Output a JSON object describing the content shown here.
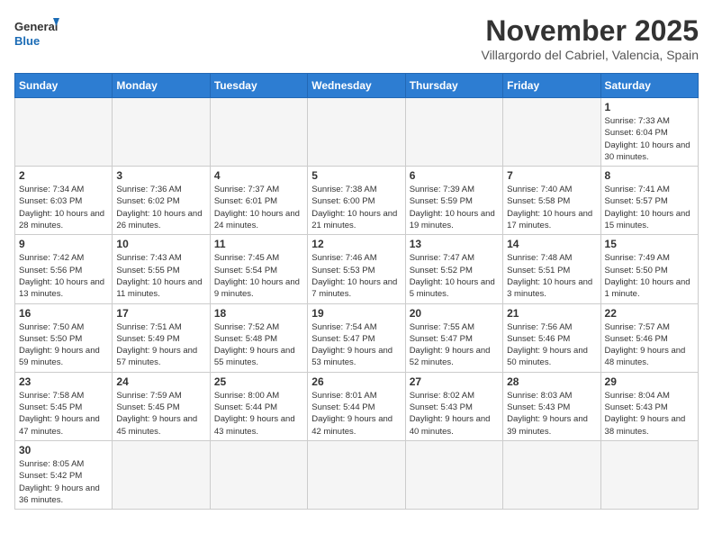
{
  "logo": {
    "line1": "General",
    "line2": "Blue"
  },
  "title": "November 2025",
  "location": "Villargordo del Cabriel, Valencia, Spain",
  "weekdays": [
    "Sunday",
    "Monday",
    "Tuesday",
    "Wednesday",
    "Thursday",
    "Friday",
    "Saturday"
  ],
  "weeks": [
    [
      {
        "day": "",
        "info": ""
      },
      {
        "day": "",
        "info": ""
      },
      {
        "day": "",
        "info": ""
      },
      {
        "day": "",
        "info": ""
      },
      {
        "day": "",
        "info": ""
      },
      {
        "day": "",
        "info": ""
      },
      {
        "day": "1",
        "info": "Sunrise: 7:33 AM\nSunset: 6:04 PM\nDaylight: 10 hours and 30 minutes."
      }
    ],
    [
      {
        "day": "2",
        "info": "Sunrise: 7:34 AM\nSunset: 6:03 PM\nDaylight: 10 hours and 28 minutes."
      },
      {
        "day": "3",
        "info": "Sunrise: 7:36 AM\nSunset: 6:02 PM\nDaylight: 10 hours and 26 minutes."
      },
      {
        "day": "4",
        "info": "Sunrise: 7:37 AM\nSunset: 6:01 PM\nDaylight: 10 hours and 24 minutes."
      },
      {
        "day": "5",
        "info": "Sunrise: 7:38 AM\nSunset: 6:00 PM\nDaylight: 10 hours and 21 minutes."
      },
      {
        "day": "6",
        "info": "Sunrise: 7:39 AM\nSunset: 5:59 PM\nDaylight: 10 hours and 19 minutes."
      },
      {
        "day": "7",
        "info": "Sunrise: 7:40 AM\nSunset: 5:58 PM\nDaylight: 10 hours and 17 minutes."
      },
      {
        "day": "8",
        "info": "Sunrise: 7:41 AM\nSunset: 5:57 PM\nDaylight: 10 hours and 15 minutes."
      }
    ],
    [
      {
        "day": "9",
        "info": "Sunrise: 7:42 AM\nSunset: 5:56 PM\nDaylight: 10 hours and 13 minutes."
      },
      {
        "day": "10",
        "info": "Sunrise: 7:43 AM\nSunset: 5:55 PM\nDaylight: 10 hours and 11 minutes."
      },
      {
        "day": "11",
        "info": "Sunrise: 7:45 AM\nSunset: 5:54 PM\nDaylight: 10 hours and 9 minutes."
      },
      {
        "day": "12",
        "info": "Sunrise: 7:46 AM\nSunset: 5:53 PM\nDaylight: 10 hours and 7 minutes."
      },
      {
        "day": "13",
        "info": "Sunrise: 7:47 AM\nSunset: 5:52 PM\nDaylight: 10 hours and 5 minutes."
      },
      {
        "day": "14",
        "info": "Sunrise: 7:48 AM\nSunset: 5:51 PM\nDaylight: 10 hours and 3 minutes."
      },
      {
        "day": "15",
        "info": "Sunrise: 7:49 AM\nSunset: 5:50 PM\nDaylight: 10 hours and 1 minute."
      }
    ],
    [
      {
        "day": "16",
        "info": "Sunrise: 7:50 AM\nSunset: 5:50 PM\nDaylight: 9 hours and 59 minutes."
      },
      {
        "day": "17",
        "info": "Sunrise: 7:51 AM\nSunset: 5:49 PM\nDaylight: 9 hours and 57 minutes."
      },
      {
        "day": "18",
        "info": "Sunrise: 7:52 AM\nSunset: 5:48 PM\nDaylight: 9 hours and 55 minutes."
      },
      {
        "day": "19",
        "info": "Sunrise: 7:54 AM\nSunset: 5:47 PM\nDaylight: 9 hours and 53 minutes."
      },
      {
        "day": "20",
        "info": "Sunrise: 7:55 AM\nSunset: 5:47 PM\nDaylight: 9 hours and 52 minutes."
      },
      {
        "day": "21",
        "info": "Sunrise: 7:56 AM\nSunset: 5:46 PM\nDaylight: 9 hours and 50 minutes."
      },
      {
        "day": "22",
        "info": "Sunrise: 7:57 AM\nSunset: 5:46 PM\nDaylight: 9 hours and 48 minutes."
      }
    ],
    [
      {
        "day": "23",
        "info": "Sunrise: 7:58 AM\nSunset: 5:45 PM\nDaylight: 9 hours and 47 minutes."
      },
      {
        "day": "24",
        "info": "Sunrise: 7:59 AM\nSunset: 5:45 PM\nDaylight: 9 hours and 45 minutes."
      },
      {
        "day": "25",
        "info": "Sunrise: 8:00 AM\nSunset: 5:44 PM\nDaylight: 9 hours and 43 minutes."
      },
      {
        "day": "26",
        "info": "Sunrise: 8:01 AM\nSunset: 5:44 PM\nDaylight: 9 hours and 42 minutes."
      },
      {
        "day": "27",
        "info": "Sunrise: 8:02 AM\nSunset: 5:43 PM\nDaylight: 9 hours and 40 minutes."
      },
      {
        "day": "28",
        "info": "Sunrise: 8:03 AM\nSunset: 5:43 PM\nDaylight: 9 hours and 39 minutes."
      },
      {
        "day": "29",
        "info": "Sunrise: 8:04 AM\nSunset: 5:43 PM\nDaylight: 9 hours and 38 minutes."
      }
    ],
    [
      {
        "day": "30",
        "info": "Sunrise: 8:05 AM\nSunset: 5:42 PM\nDaylight: 9 hours and 36 minutes."
      },
      {
        "day": "",
        "info": ""
      },
      {
        "day": "",
        "info": ""
      },
      {
        "day": "",
        "info": ""
      },
      {
        "day": "",
        "info": ""
      },
      {
        "day": "",
        "info": ""
      },
      {
        "day": "",
        "info": ""
      }
    ]
  ]
}
